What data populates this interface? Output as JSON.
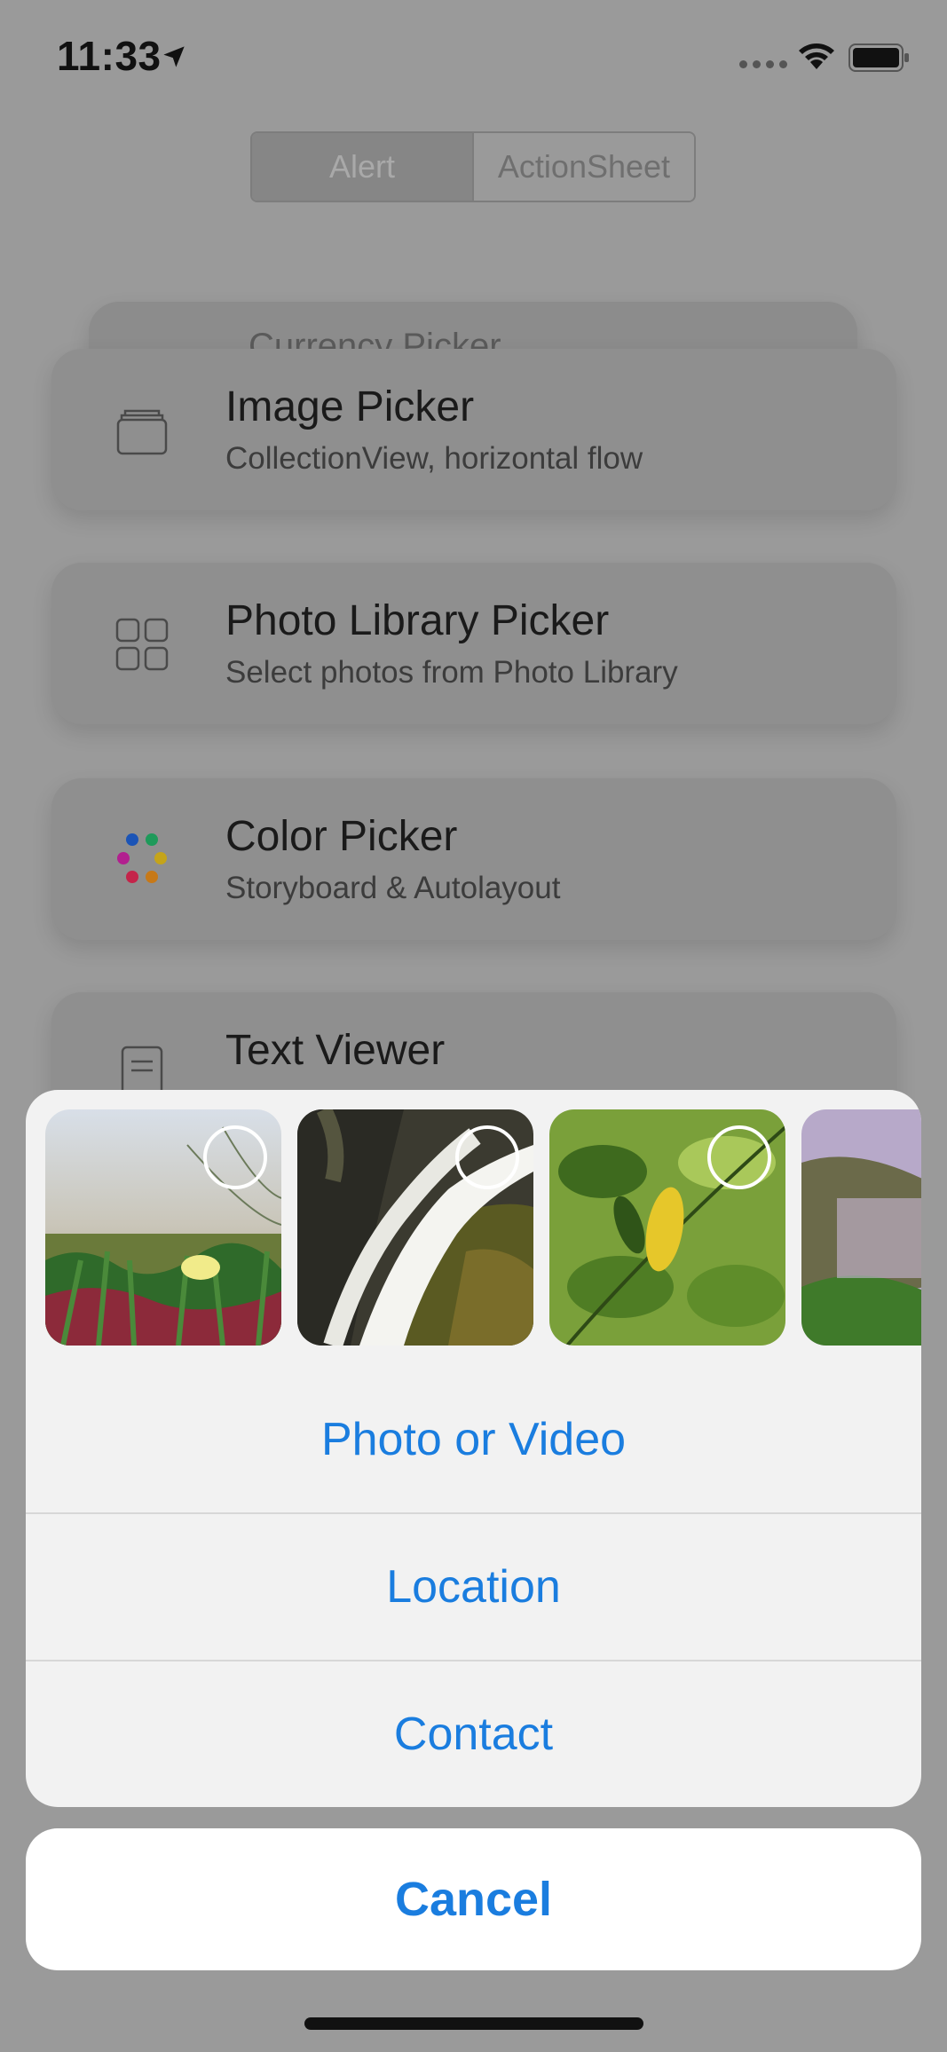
{
  "status_bar": {
    "time": "11:33"
  },
  "segmented_control": {
    "alert": "Alert",
    "action_sheet": "ActionSheet"
  },
  "cards": {
    "back": {
      "title": "Currency Picker"
    },
    "image_picker": {
      "title": "Image Picker",
      "subtitle": "CollectionView, horizontal flow",
      "icon": "stack-icon"
    },
    "photo_library": {
      "title": "Photo Library Picker",
      "subtitle": "Select photos from Photo Library",
      "icon": "grid-icon"
    },
    "color_picker": {
      "title": "Color Picker",
      "subtitle": "Storyboard & Autolayout",
      "icon": "color-dots-icon"
    },
    "text_viewer": {
      "title": "Text Viewer",
      "icon": "document-icon"
    }
  },
  "action_sheet": {
    "items": [
      "Photo or Video",
      "Location",
      "Contact"
    ],
    "cancel": "Cancel"
  },
  "colors": {
    "accent": "#1a7ddf",
    "dim_background": "#9a9a9a"
  }
}
